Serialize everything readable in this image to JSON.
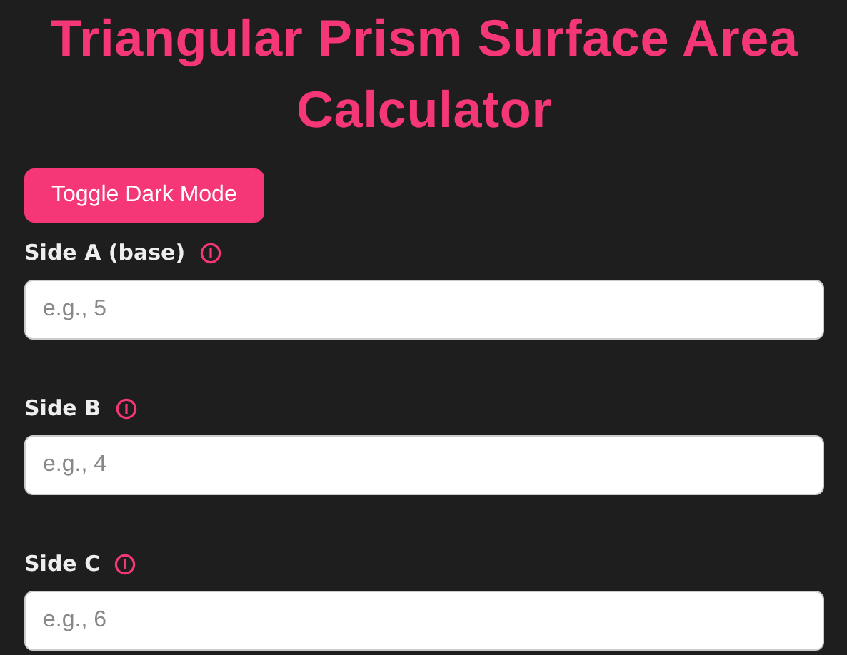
{
  "title": "Triangular Prism Surface Area Calculator",
  "toggle_button": {
    "label": "Toggle Dark Mode"
  },
  "fields": [
    {
      "label": "Side A (base)",
      "placeholder": "e.g., 5"
    },
    {
      "label": "Side B",
      "placeholder": "e.g., 4"
    },
    {
      "label": "Side C",
      "placeholder": "e.g., 6"
    }
  ]
}
